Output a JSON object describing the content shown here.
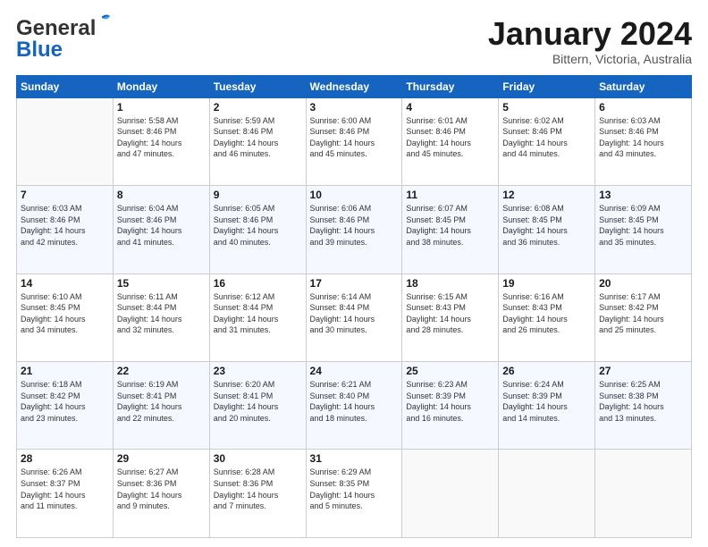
{
  "logo": {
    "general": "General",
    "blue": "Blue"
  },
  "header": {
    "title": "January 2024",
    "location": "Bittern, Victoria, Australia"
  },
  "weekdays": [
    "Sunday",
    "Monday",
    "Tuesday",
    "Wednesday",
    "Thursday",
    "Friday",
    "Saturday"
  ],
  "weeks": [
    [
      {
        "day": "",
        "info": ""
      },
      {
        "day": "1",
        "info": "Sunrise: 5:58 AM\nSunset: 8:46 PM\nDaylight: 14 hours\nand 47 minutes."
      },
      {
        "day": "2",
        "info": "Sunrise: 5:59 AM\nSunset: 8:46 PM\nDaylight: 14 hours\nand 46 minutes."
      },
      {
        "day": "3",
        "info": "Sunrise: 6:00 AM\nSunset: 8:46 PM\nDaylight: 14 hours\nand 45 minutes."
      },
      {
        "day": "4",
        "info": "Sunrise: 6:01 AM\nSunset: 8:46 PM\nDaylight: 14 hours\nand 45 minutes."
      },
      {
        "day": "5",
        "info": "Sunrise: 6:02 AM\nSunset: 8:46 PM\nDaylight: 14 hours\nand 44 minutes."
      },
      {
        "day": "6",
        "info": "Sunrise: 6:03 AM\nSunset: 8:46 PM\nDaylight: 14 hours\nand 43 minutes."
      }
    ],
    [
      {
        "day": "7",
        "info": "Sunrise: 6:03 AM\nSunset: 8:46 PM\nDaylight: 14 hours\nand 42 minutes."
      },
      {
        "day": "8",
        "info": "Sunrise: 6:04 AM\nSunset: 8:46 PM\nDaylight: 14 hours\nand 41 minutes."
      },
      {
        "day": "9",
        "info": "Sunrise: 6:05 AM\nSunset: 8:46 PM\nDaylight: 14 hours\nand 40 minutes."
      },
      {
        "day": "10",
        "info": "Sunrise: 6:06 AM\nSunset: 8:46 PM\nDaylight: 14 hours\nand 39 minutes."
      },
      {
        "day": "11",
        "info": "Sunrise: 6:07 AM\nSunset: 8:45 PM\nDaylight: 14 hours\nand 38 minutes."
      },
      {
        "day": "12",
        "info": "Sunrise: 6:08 AM\nSunset: 8:45 PM\nDaylight: 14 hours\nand 36 minutes."
      },
      {
        "day": "13",
        "info": "Sunrise: 6:09 AM\nSunset: 8:45 PM\nDaylight: 14 hours\nand 35 minutes."
      }
    ],
    [
      {
        "day": "14",
        "info": "Sunrise: 6:10 AM\nSunset: 8:45 PM\nDaylight: 14 hours\nand 34 minutes."
      },
      {
        "day": "15",
        "info": "Sunrise: 6:11 AM\nSunset: 8:44 PM\nDaylight: 14 hours\nand 32 minutes."
      },
      {
        "day": "16",
        "info": "Sunrise: 6:12 AM\nSunset: 8:44 PM\nDaylight: 14 hours\nand 31 minutes."
      },
      {
        "day": "17",
        "info": "Sunrise: 6:14 AM\nSunset: 8:44 PM\nDaylight: 14 hours\nand 30 minutes."
      },
      {
        "day": "18",
        "info": "Sunrise: 6:15 AM\nSunset: 8:43 PM\nDaylight: 14 hours\nand 28 minutes."
      },
      {
        "day": "19",
        "info": "Sunrise: 6:16 AM\nSunset: 8:43 PM\nDaylight: 14 hours\nand 26 minutes."
      },
      {
        "day": "20",
        "info": "Sunrise: 6:17 AM\nSunset: 8:42 PM\nDaylight: 14 hours\nand 25 minutes."
      }
    ],
    [
      {
        "day": "21",
        "info": "Sunrise: 6:18 AM\nSunset: 8:42 PM\nDaylight: 14 hours\nand 23 minutes."
      },
      {
        "day": "22",
        "info": "Sunrise: 6:19 AM\nSunset: 8:41 PM\nDaylight: 14 hours\nand 22 minutes."
      },
      {
        "day": "23",
        "info": "Sunrise: 6:20 AM\nSunset: 8:41 PM\nDaylight: 14 hours\nand 20 minutes."
      },
      {
        "day": "24",
        "info": "Sunrise: 6:21 AM\nSunset: 8:40 PM\nDaylight: 14 hours\nand 18 minutes."
      },
      {
        "day": "25",
        "info": "Sunrise: 6:23 AM\nSunset: 8:39 PM\nDaylight: 14 hours\nand 16 minutes."
      },
      {
        "day": "26",
        "info": "Sunrise: 6:24 AM\nSunset: 8:39 PM\nDaylight: 14 hours\nand 14 minutes."
      },
      {
        "day": "27",
        "info": "Sunrise: 6:25 AM\nSunset: 8:38 PM\nDaylight: 14 hours\nand 13 minutes."
      }
    ],
    [
      {
        "day": "28",
        "info": "Sunrise: 6:26 AM\nSunset: 8:37 PM\nDaylight: 14 hours\nand 11 minutes."
      },
      {
        "day": "29",
        "info": "Sunrise: 6:27 AM\nSunset: 8:36 PM\nDaylight: 14 hours\nand 9 minutes."
      },
      {
        "day": "30",
        "info": "Sunrise: 6:28 AM\nSunset: 8:36 PM\nDaylight: 14 hours\nand 7 minutes."
      },
      {
        "day": "31",
        "info": "Sunrise: 6:29 AM\nSunset: 8:35 PM\nDaylight: 14 hours\nand 5 minutes."
      },
      {
        "day": "",
        "info": ""
      },
      {
        "day": "",
        "info": ""
      },
      {
        "day": "",
        "info": ""
      }
    ]
  ]
}
